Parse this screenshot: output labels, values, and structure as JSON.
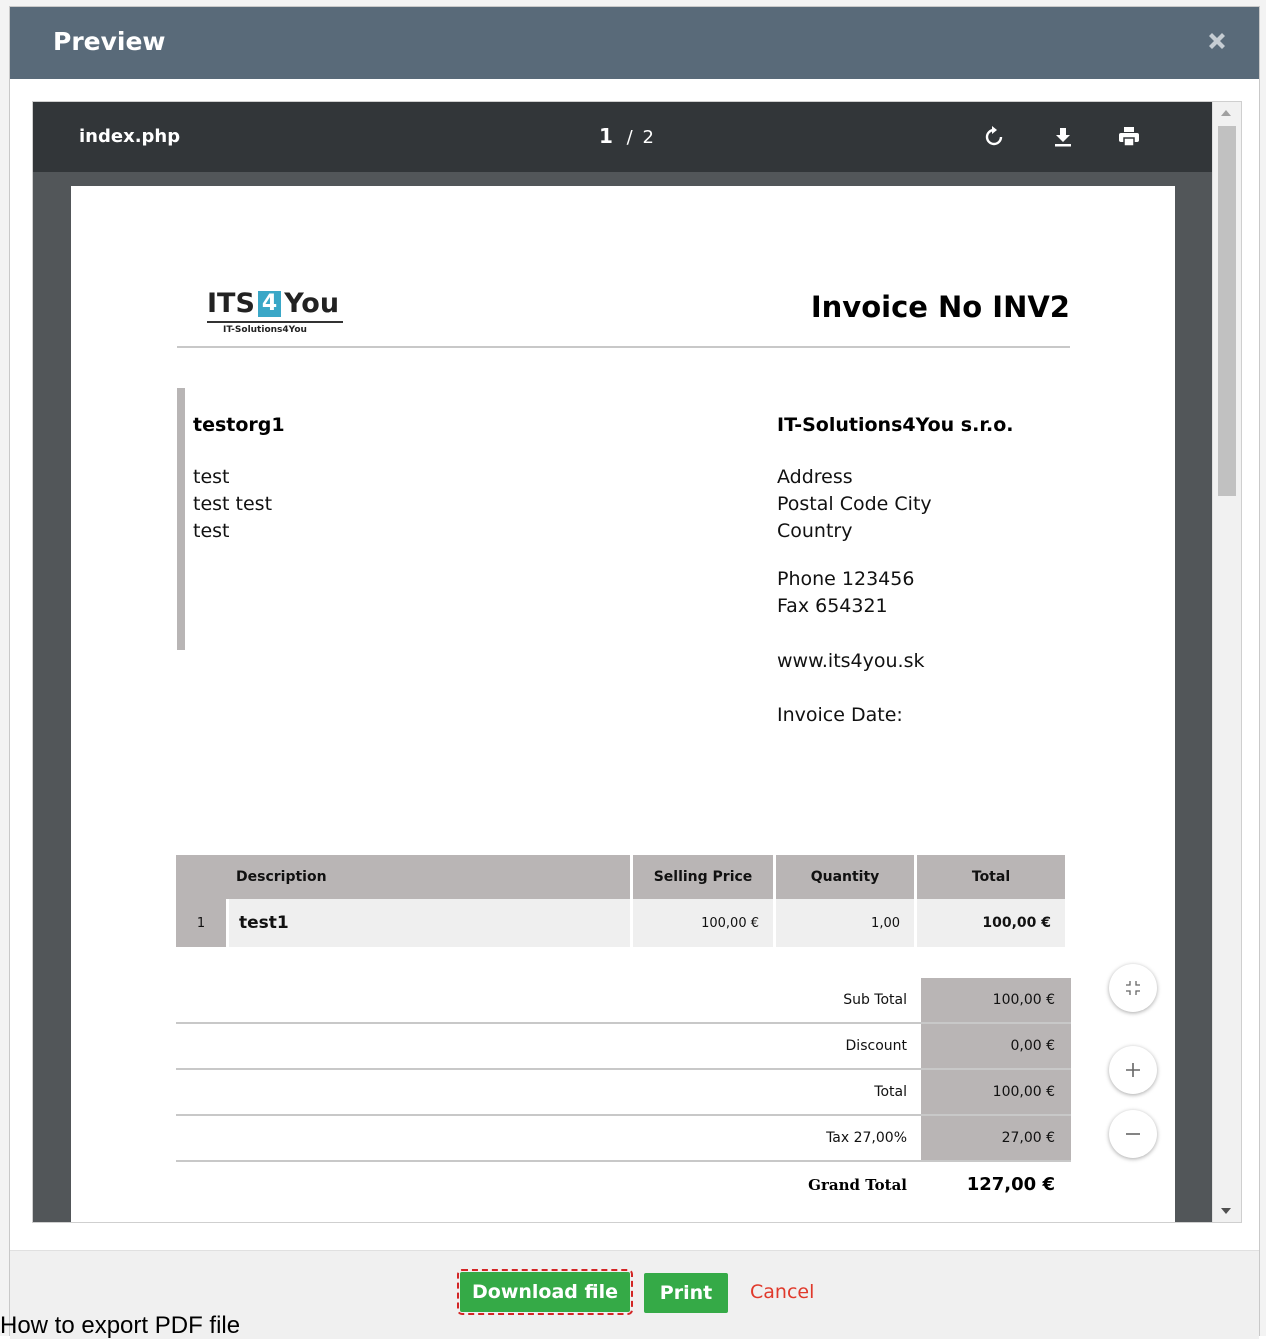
{
  "modal": {
    "title": "Preview"
  },
  "viewer": {
    "filename": "index.php",
    "current_page": "1",
    "page_separator": "/",
    "total_pages": "2"
  },
  "invoice": {
    "logo_brand_left": "ITS",
    "logo_brand_num": "4",
    "logo_brand_right": "You",
    "logo_sub": "IT-Solutions4You",
    "title": "Invoice No INV2",
    "customer": {
      "name": "testorg1",
      "lines": [
        "test",
        "test test",
        "test"
      ]
    },
    "company": {
      "name": "IT-Solutions4You s.r.o.",
      "address": [
        "Address",
        "Postal Code City",
        "Country"
      ],
      "contact": [
        "Phone 123456",
        "Fax 654321"
      ],
      "web": "www.its4you.sk",
      "date_label": "Invoice Date:"
    },
    "table": {
      "headers": [
        "Description",
        "Selling Price",
        "Quantity",
        "Total"
      ],
      "rows": [
        {
          "num": "1",
          "description": "test1",
          "price": "100,00 €",
          "quantity": "1,00",
          "total": "100,00 €"
        }
      ]
    },
    "totals": [
      {
        "label": "Sub Total",
        "value": "100,00 €"
      },
      {
        "label": "Discount",
        "value": "0,00 €"
      },
      {
        "label": "Total",
        "value": "100,00 €"
      },
      {
        "label": "Tax 27,00%",
        "value": "27,00 €"
      }
    ],
    "grand_total": {
      "label": "Grand Total",
      "value": "127,00 €"
    }
  },
  "footer": {
    "download_label": "Download file",
    "print_label": "Print",
    "cancel_label": "Cancel"
  },
  "caption": "How to export PDF file",
  "icons": {
    "close": "close-icon",
    "rotate": "rotate-icon",
    "download": "download-icon",
    "print": "print-icon",
    "fit": "fit-page-icon",
    "zoom_in": "zoom-in-icon",
    "zoom_out": "zoom-out-icon"
  },
  "colors": {
    "header_bg": "#596a79",
    "accent_green": "#35aa47",
    "cancel_red": "#e0392b",
    "logo_blue": "#3aa7c7",
    "table_gray": "#b9b5b5"
  }
}
